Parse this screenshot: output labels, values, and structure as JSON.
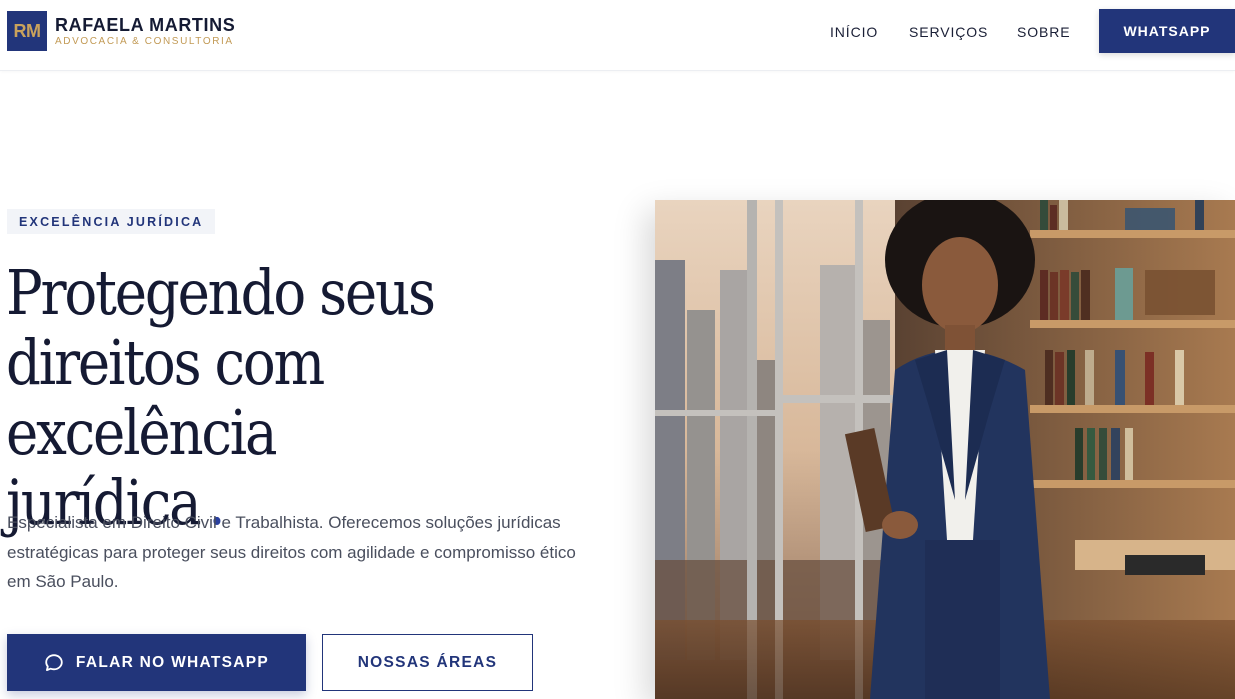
{
  "header": {
    "logo_mark": "RM",
    "brand_name": "RAFAELA MARTINS",
    "brand_sub": "ADVOCACIA & CONSULTORIA",
    "nav": {
      "inicio": "INÍCIO",
      "servicos": "SERVIÇOS",
      "sobre": "SOBRE"
    },
    "cta_label": "WHATSAPP"
  },
  "hero": {
    "badge": "EXCELÊNCIA JURÍDICA",
    "headline_line1": "Protegendo seus",
    "headline_line2": "direitos com excelência",
    "headline_line3": "jurídica",
    "headline_dot": ".",
    "lead": "Especialista em Direito Civil e Trabalhista. Oferecemos soluções jurídicas estratégicas para proteger seus direitos com agilidade e compromisso ético em São Paulo.",
    "primary_button": "FALAR NO WHATSAPP",
    "secondary_button": "NOSSAS ÁREAS"
  },
  "colors": {
    "primary": "#22357a",
    "gold": "#c29a55",
    "text": "#151a33"
  },
  "icons": {
    "chat": "chat-bubble-icon"
  }
}
